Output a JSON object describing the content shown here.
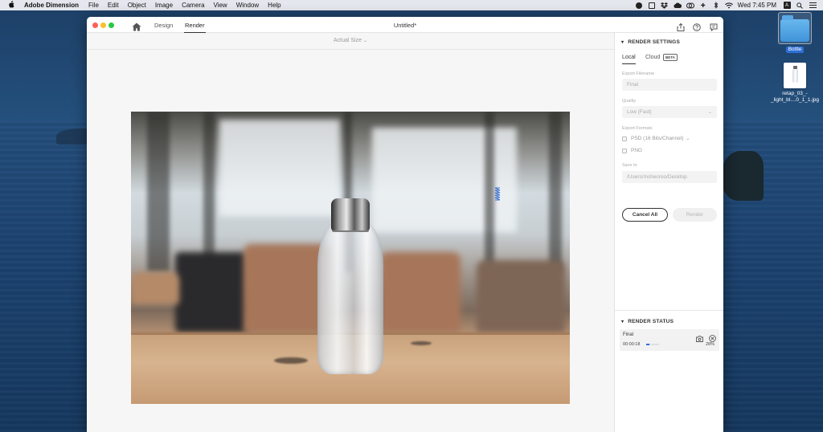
{
  "menubar": {
    "app_name": "Adobe Dimension",
    "items": [
      "File",
      "Edit",
      "Object",
      "Image",
      "Camera",
      "View",
      "Window",
      "Help"
    ],
    "clock": "Wed 7:45 PM"
  },
  "desktop": {
    "folder_label": "Bottle",
    "file_label_line1": "retap_03_-",
    "file_label_line2": "_light_bl....0_1_1.jpg"
  },
  "window": {
    "title": "Untitled*",
    "tabs": {
      "design": "Design",
      "render": "Render"
    },
    "active_tab": "Render"
  },
  "canvas": {
    "zoom_label": "Actual Size",
    "zoom_chevron": "⌄"
  },
  "render_settings": {
    "heading": "RENDER SETTINGS",
    "tab_local": "Local",
    "tab_cloud": "Cloud",
    "beta_badge": "BETA",
    "export_filename_label": "Export Filename",
    "export_filename_value": "Final",
    "quality_label": "Quality",
    "quality_value": "Low (Fast)",
    "export_formats_label": "Export Formats",
    "format_psd": "PSD (16 Bits/Channel)",
    "format_png": "PNG",
    "save_to_label": "Save to",
    "save_to_value": "/Users/mshecroo/Desktop",
    "cancel_all_button": "Cancel All",
    "render_button": "Render"
  },
  "render_status": {
    "heading": "RENDER STATUS",
    "job_name": "Final",
    "elapsed": "00:00:18",
    "progress_percent": 28,
    "progress_label": "28%"
  },
  "colors": {
    "accent_blue": "#2d6ed6",
    "close": "#fe5f57",
    "minimize": "#febc2e",
    "zoom": "#28c840"
  }
}
